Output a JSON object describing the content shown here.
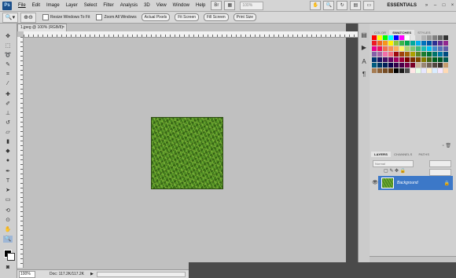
{
  "menubar": {
    "logo": "Ps",
    "items": [
      "File",
      "Edit",
      "Image",
      "Layer",
      "Select",
      "Filter",
      "Analysis",
      "3D",
      "View",
      "Window",
      "Help"
    ],
    "zoom": "100%",
    "workspace": "ESSENTIALS"
  },
  "options": {
    "resize_windows": "Resize Windows To Fit",
    "zoom_all": "Zoom All Windows",
    "actual_pixels": "Actual Pixels",
    "fit_screen": "Fit Screen",
    "fill_screen": "Fill Screen",
    "print_size": "Print Size"
  },
  "document": {
    "tab_title": "1.jpeg @ 100% (RGB/8)",
    "zoom": "100%",
    "doc_size": "Doc: 117.2K/117.2K"
  },
  "panels": {
    "swatch_tabs": [
      "COLOR",
      "SWATCHES",
      "STYLES"
    ],
    "swatch_active": "SWATCHES",
    "layer_tabs": [
      "LAYERS",
      "CHANNELS",
      "PATHS"
    ],
    "layer_active": "LAYERS",
    "blend_mode": "Normal",
    "layer_name": "Background"
  },
  "swatch_colors": [
    "#ff0000",
    "#ffff00",
    "#00ff00",
    "#00ffff",
    "#0000ff",
    "#ff00ff",
    "#ffffff",
    "#e6e6e6",
    "#cccccc",
    "#b3b3b3",
    "#999999",
    "#808080",
    "#666666",
    "#333333",
    "#ed1c24",
    "#f26522",
    "#f7941d",
    "#fff200",
    "#8dc63f",
    "#39b54a",
    "#00a651",
    "#00a99d",
    "#00aeef",
    "#0072bc",
    "#0054a6",
    "#2e3192",
    "#662d91",
    "#92278f",
    "#ec008c",
    "#ed145b",
    "#f26c4f",
    "#f68e56",
    "#fbaf5d",
    "#fff568",
    "#acd373",
    "#7cc576",
    "#3bb878",
    "#1abbb4",
    "#00bff3",
    "#438ccb",
    "#5574b9",
    "#605ca8",
    "#8560a8",
    "#a864a8",
    "#f06eaa",
    "#f26d7d",
    "#9e0b0f",
    "#a0410d",
    "#a36209",
    "#aba000",
    "#598527",
    "#1a7b30",
    "#007236",
    "#00746b",
    "#0076a3",
    "#004b80",
    "#003471",
    "#1b1464",
    "#440e62",
    "#630460",
    "#9e005d",
    "#9e0039",
    "#790000",
    "#7b2e00",
    "#7d4900",
    "#827b00",
    "#406618",
    "#005e20",
    "#005826",
    "#005952",
    "#005b7f",
    "#003663",
    "#002157",
    "#0d004c",
    "#32004b",
    "#4b0049",
    "#7b0046",
    "#7a0026",
    "#c7b299",
    "#998675",
    "#736357",
    "#534741",
    "#37302a",
    "#c69c6d",
    "#a67c52",
    "#8c6239",
    "#754c24",
    "#603913",
    "#000000",
    "#1a1a1a",
    "#4d4d4d",
    "#ffe6e6",
    "#e6ffe6",
    "#e6e6ff",
    "#fff0cc",
    "#d9ecff",
    "#f5e6ff",
    "#ffd9b3"
  ]
}
